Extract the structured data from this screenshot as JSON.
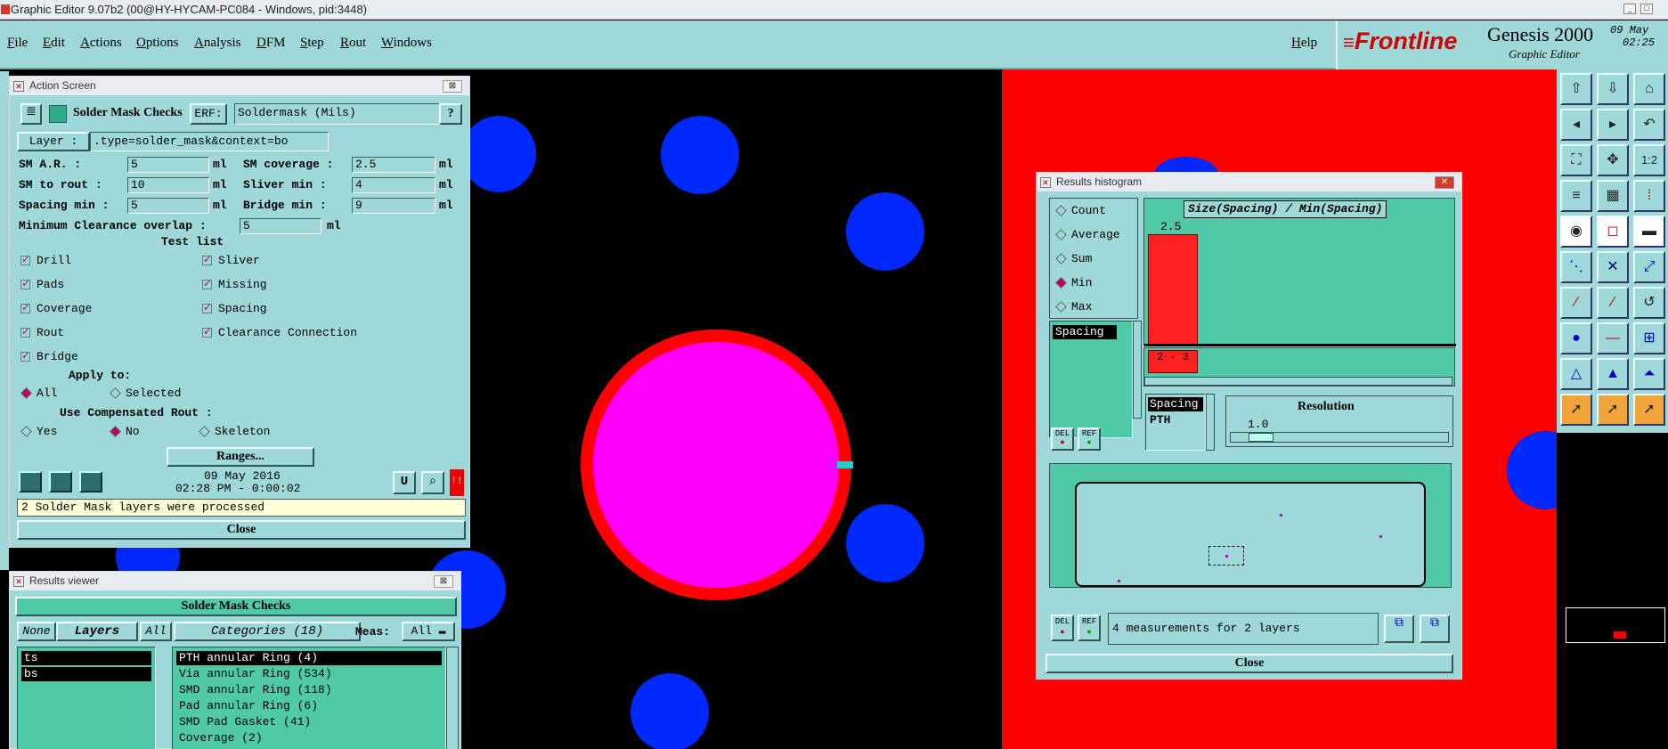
{
  "window": {
    "title": "Graphic Editor 9.07b2 (00@HY-HYCAM-PC084 - Windows, pid:3448)"
  },
  "menu": {
    "items": [
      "File",
      "Edit",
      "Actions",
      "Options",
      "Analysis",
      "DFM",
      "Step",
      "Rout",
      "Windows"
    ],
    "help": "Help"
  },
  "brand": {
    "logo": "Frontline",
    "product": "Genesis 2000",
    "subtitle": "Graphic Editor",
    "date": "09 May",
    "time": "02:25"
  },
  "action_screen": {
    "title": "Action Screen",
    "program": "Solder Mask Checks",
    "erf_label": "ERF:",
    "erf_value": "Soldermask (Mils)",
    "help": "?",
    "layer_label": "Layer :",
    "layer_value": ".type=solder_mask&context=bo",
    "params": [
      {
        "label": "SM A.R.     :",
        "value": "5",
        "unit": "ml"
      },
      {
        "label": "SM to rout  :",
        "value": "10",
        "unit": "ml"
      },
      {
        "label": "Spacing min :",
        "value": "5",
        "unit": "ml"
      },
      {
        "label": "SM coverage :",
        "value": "2.5",
        "unit": "ml"
      },
      {
        "label": "Sliver  min :",
        "value": "4",
        "unit": "ml"
      },
      {
        "label": "Bridge  min :",
        "value": "9",
        "unit": "ml"
      }
    ],
    "overlap_label": "Minimum Clearance overlap :",
    "overlap_value": "5",
    "overlap_unit": "ml",
    "test_list_label": "Test list",
    "tests_left": [
      "Drill",
      "Pads",
      "Coverage",
      "Rout",
      "Bridge"
    ],
    "tests_right": [
      "Sliver",
      "Missing",
      "Spacing",
      "Clearance Connection"
    ],
    "apply_label": "Apply to:",
    "apply_options": [
      "All",
      "Selected"
    ],
    "comp_label": "Use Compensated Rout :",
    "comp_options": [
      "Yes",
      "No",
      "Skeleton"
    ],
    "ranges_button": "Ranges...",
    "run_date": "09 May 2016",
    "run_time": "02:28 PM - 0:00:02",
    "status": "2 Solder Mask layers were processed",
    "close": "Close"
  },
  "results_viewer": {
    "title": "Results viewer",
    "header": "Solder Mask Checks",
    "btn_none": "None",
    "btn_layers": "Layers",
    "btn_all": "All",
    "categories_label": "Categories (18)",
    "meas_label": "Meas:",
    "meas_value": "All",
    "layers": [
      "ts",
      "bs"
    ],
    "categories": [
      "PTH annular Ring (4)",
      "Via annular Ring (534)",
      "SMD annular Ring (118)",
      "Pad annular Ring (6)",
      "SMD Pad Gasket (41)",
      "Coverage (2)"
    ]
  },
  "histogram": {
    "title": "Results histogram",
    "modes": [
      "Count",
      "Average",
      "Sum",
      "Min",
      "Max"
    ],
    "selected_mode": "Min",
    "chart_title": "Size(Spacing) / Min(Spacing)",
    "bar_value": "2.5",
    "bin_label": "2 - 3",
    "list_item": "Spacing",
    "del": "DEL",
    "ref": "REF",
    "sub_items": [
      "Spacing",
      "PTH"
    ],
    "resolution_label": "Resolution",
    "resolution_value": "1.0",
    "status": "4 measurements for 2 layers",
    "close": "Close"
  },
  "colors": {
    "panel": "#9fd8d8",
    "list": "#4fc9a6",
    "pad": "#0028ff",
    "mask": "#ff0000",
    "magenta": "#ff00ff"
  }
}
